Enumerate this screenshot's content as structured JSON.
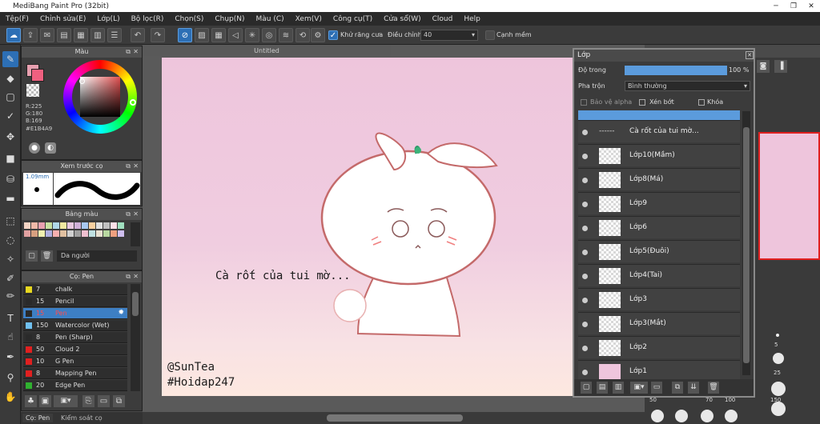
{
  "app": {
    "title": "MediBang Paint Pro (32bit)"
  },
  "menu": [
    "Tệp(F)",
    "Chỉnh sửa(E)",
    "Lớp(L)",
    "Bộ lọc(R)",
    "Chọn(S)",
    "Chụp(N)",
    "Màu (C)",
    "Xem(V)",
    "Công cụ(T)",
    "Cửa sổ(W)",
    "Cloud",
    "Help"
  ],
  "toolbar": {
    "antialias_label": "Khử răng cưa",
    "adjust_label": "Điều chỉnh",
    "adjust_value": "40",
    "smooth_label": "Cạnh mềm"
  },
  "color_panel": {
    "title": "Màu",
    "r": "R:225",
    "g": "G:180",
    "b": "B:169",
    "hex": "#E1B4A9",
    "fg_color": "#e1b4a9",
    "accent": "#e8a0b0"
  },
  "brush_preview": {
    "title": "Xem trước cọ",
    "size": "1.09mm"
  },
  "palette": {
    "title": "Bảng màu",
    "name": "Da người",
    "colors": [
      "#f4d4c4",
      "#f0b8a8",
      "#e8a0b0",
      "#c8e0a0",
      "#b0d8e8",
      "#f0e8a0",
      "#e8c8e0",
      "#d0b0d8",
      "#a8c8f0",
      "#f8d0a0",
      "#e0e0e0",
      "#c0c0c0",
      "#ffe0e8",
      "#a0e0c0",
      "#e0a0a0",
      "#d8a080",
      "#f0f0b0",
      "#b0b0e0",
      "#f8b0b0",
      "#e0c0a0",
      "#d0d0d0",
      "#a0a0a0",
      "#f0c0d0",
      "#c0e0e0",
      "#e8e0d0",
      "#b8d8a0",
      "#f0a080",
      "#d0c0f0"
    ]
  },
  "brush_panel": {
    "title": "Cọ: Pen",
    "brushes": [
      {
        "size": "7",
        "name": "chalk",
        "color": "#e8d820"
      },
      {
        "size": "15",
        "name": "Pencil",
        "color": "#2a2a2a"
      },
      {
        "size": "15",
        "name": "Pen",
        "color": "#2a2a2a"
      },
      {
        "size": "150",
        "name": "Watercolor (Wet)",
        "color": "#70c0f0"
      },
      {
        "size": "8",
        "name": "Pen (Sharp)",
        "color": "#2a2a2a"
      },
      {
        "size": "50",
        "name": "Cloud 2",
        "color": "#e02020"
      },
      {
        "size": "10",
        "name": "G Pen",
        "color": "#e02020"
      },
      {
        "size": "8",
        "name": "Mapping Pen",
        "color": "#e02020"
      },
      {
        "size": "20",
        "name": "Edge Pen",
        "color": "#30b030"
      }
    ]
  },
  "bottom_tabs": [
    "Cọ: Pen",
    "Kiểm soát cọ"
  ],
  "document": {
    "tab": "Untitled"
  },
  "canvas_text": {
    "caption": "Cà rốt của tui mờ...",
    "credit1": "@SunTea",
    "credit2": "#Hoidap247"
  },
  "layer_panel": {
    "title": "Lớp",
    "opacity_label": "Độ trong",
    "opacity_value": "100 %",
    "blend_label": "Pha trộn",
    "blend_value": "Bình thường",
    "protect_alpha": "Bảo vệ alpha",
    "clip": "Xén bớt",
    "lock": "Khóa",
    "layers": [
      "Cà rốt của tui mờ...",
      "Lớp10(Mầm)",
      "Lớp8(Má)",
      "Lớp9",
      "Lớp6",
      "Lớp5(Đuôi)",
      "Lớp4(Tai)",
      "Lớp3",
      "Lớp3(Mắt)",
      "Lớp2",
      "Lớp1"
    ]
  },
  "brush_sizes": [
    "5",
    "25",
    "50",
    "70",
    "100",
    "150"
  ]
}
